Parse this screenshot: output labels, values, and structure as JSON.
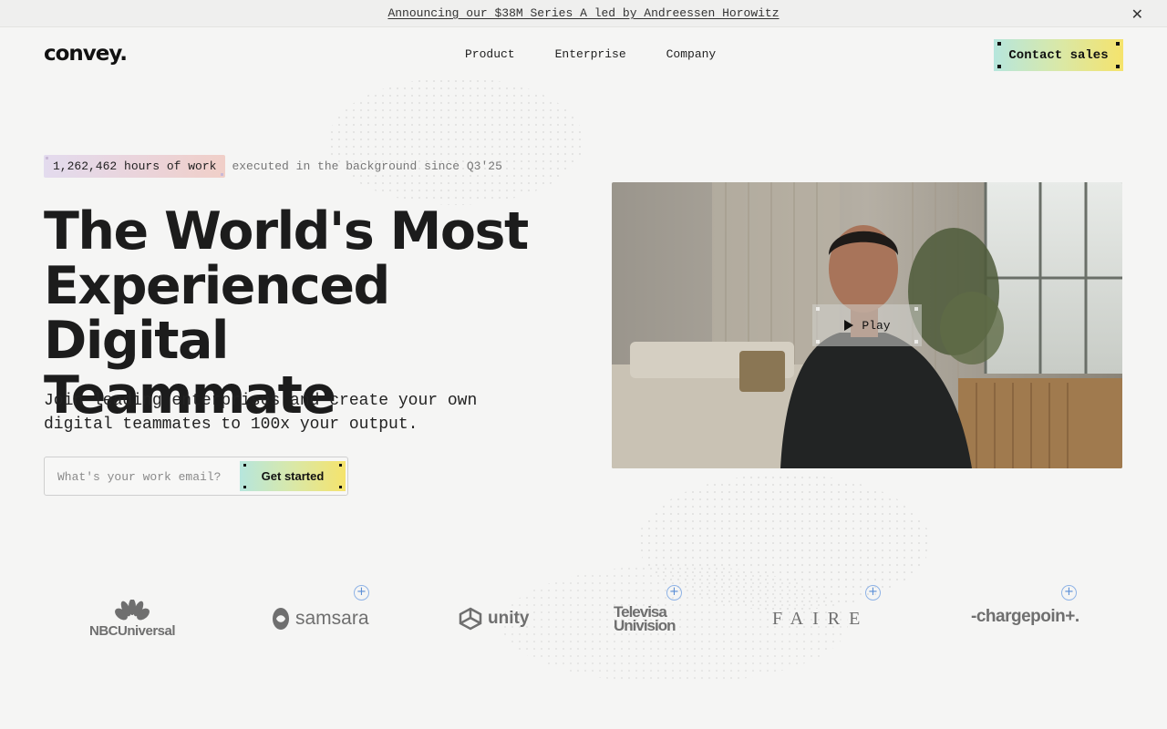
{
  "announcement": {
    "text": "Announcing our $38M Series A led by Andreessen Horowitz",
    "close_icon": "close-icon"
  },
  "brand": {
    "name": "convey."
  },
  "nav": {
    "items": [
      "Product",
      "Enterprise",
      "Company"
    ]
  },
  "header": {
    "contact_label": "Contact sales"
  },
  "badge": {
    "highlight": "1,262,462 hours of work",
    "tail": "executed in the background since Q3'25"
  },
  "hero": {
    "title_line1": "The World's Most",
    "title_line2": "Experienced Digital",
    "title_line3": "Teammate",
    "subtitle": "Join leading enterprises and create your own digital teammates to 100x your output."
  },
  "form": {
    "email_placeholder": "What's your work email?",
    "submit_label": "Get started"
  },
  "video": {
    "play_label": "Play"
  },
  "logos": {
    "nbc": "NBCUniversal",
    "samsara": "samsara",
    "unity": "unity",
    "televisa_1": "Televisa",
    "televisa_2": "Univision",
    "faire": "FAIRE",
    "chargepoint": "-chargepoin+."
  },
  "colors": {
    "accent_gradient_start": "#b6e6dd",
    "accent_gradient_end": "#f5e36c",
    "plus_icon": "#5b8ed6"
  }
}
